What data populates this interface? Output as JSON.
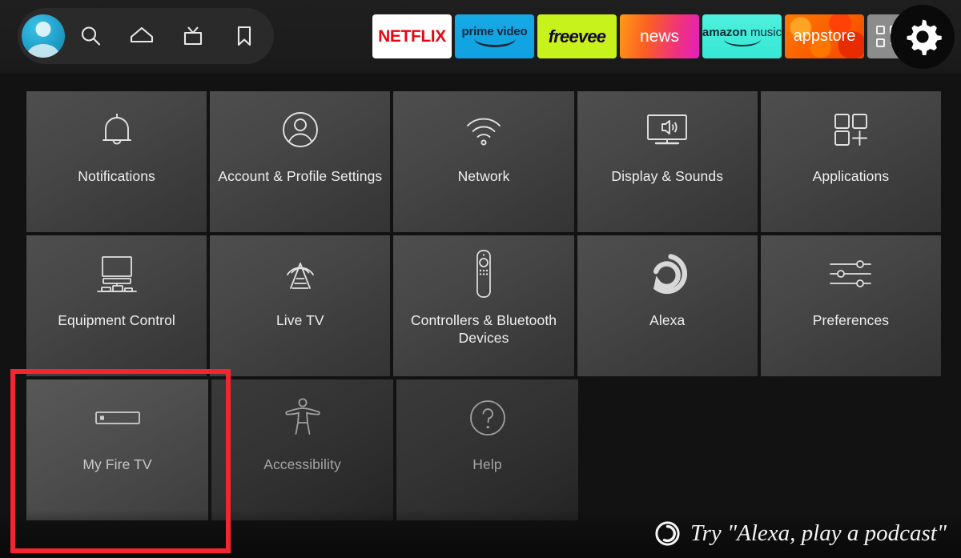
{
  "topbar": {
    "profile": {
      "name": "profile-avatar",
      "label": "Profile"
    },
    "nav_icons": [
      {
        "id": "search-icon",
        "label": "Search"
      },
      {
        "id": "home-icon",
        "label": "Home"
      },
      {
        "id": "live-tv-icon",
        "label": "Live TV"
      },
      {
        "id": "bookmark-icon",
        "label": "Watchlist"
      }
    ],
    "apps": [
      {
        "id": "netflix",
        "label": "NETFLIX",
        "bg": "#ffffff",
        "fg": "#e50914"
      },
      {
        "id": "prime-video",
        "label": "prime video",
        "bg": "#16aae5",
        "fg": "#14263a"
      },
      {
        "id": "freevee",
        "label": "freevee",
        "bg": "#c8f21c",
        "fg": "#13052e"
      },
      {
        "id": "news",
        "label": "news",
        "bg": "#fb5f24",
        "fg": "#ffffff"
      },
      {
        "id": "amazon-music",
        "label_bold": "amazon",
        "label_light": "music",
        "bg": "#37e7d6",
        "fg": "#0d2a33"
      },
      {
        "id": "appstore",
        "label": "appstore",
        "bg": "#f34600",
        "fg": "#ffffff"
      }
    ],
    "apps_grid_label": "Apps",
    "settings_label": "Settings",
    "settings_selected": true
  },
  "grid": {
    "rows": [
      [
        {
          "id": "notifications",
          "icon": "bell-icon",
          "label": "Notifications",
          "state": "normal"
        },
        {
          "id": "account-profile-settings",
          "icon": "person-circle-icon",
          "label": "Account & Profile Settings",
          "state": "normal"
        },
        {
          "id": "network",
          "icon": "wifi-icon",
          "label": "Network",
          "state": "normal"
        },
        {
          "id": "display-sounds",
          "icon": "tv-speaker-icon",
          "label": "Display & Sounds",
          "state": "normal"
        },
        {
          "id": "applications",
          "icon": "apps-grid-plus-icon",
          "label": "Applications",
          "state": "normal"
        }
      ],
      [
        {
          "id": "equipment-control",
          "icon": "tv-equipment-icon",
          "label": "Equipment Control",
          "state": "normal"
        },
        {
          "id": "live-tv",
          "icon": "broadcast-tower-icon",
          "label": "Live TV",
          "state": "normal"
        },
        {
          "id": "controllers-bluetooth-devices",
          "icon": "remote-control-icon",
          "label": "Controllers & Bluetooth Devices",
          "state": "normal"
        },
        {
          "id": "alexa",
          "icon": "alexa-ring-icon",
          "label": "Alexa",
          "state": "normal"
        },
        {
          "id": "preferences",
          "icon": "sliders-icon",
          "label": "Preferences",
          "state": "normal"
        }
      ],
      [
        {
          "id": "my-fire-tv",
          "icon": "fire-tv-stick-icon",
          "label": "My Fire TV",
          "state": "focused"
        },
        {
          "id": "accessibility",
          "icon": "accessibility-icon",
          "label": "Accessibility",
          "state": "dim"
        },
        {
          "id": "help",
          "icon": "question-circle-icon",
          "label": "Help",
          "state": "dim"
        }
      ]
    ]
  },
  "annotation": {
    "id": "highlight-box-my-fire-tv",
    "color": "#f5252f",
    "target": "My Fire TV"
  },
  "alexa_hint": {
    "icon": "alexa-ring-icon",
    "text": "Try \"Alexa, play a podcast\""
  }
}
